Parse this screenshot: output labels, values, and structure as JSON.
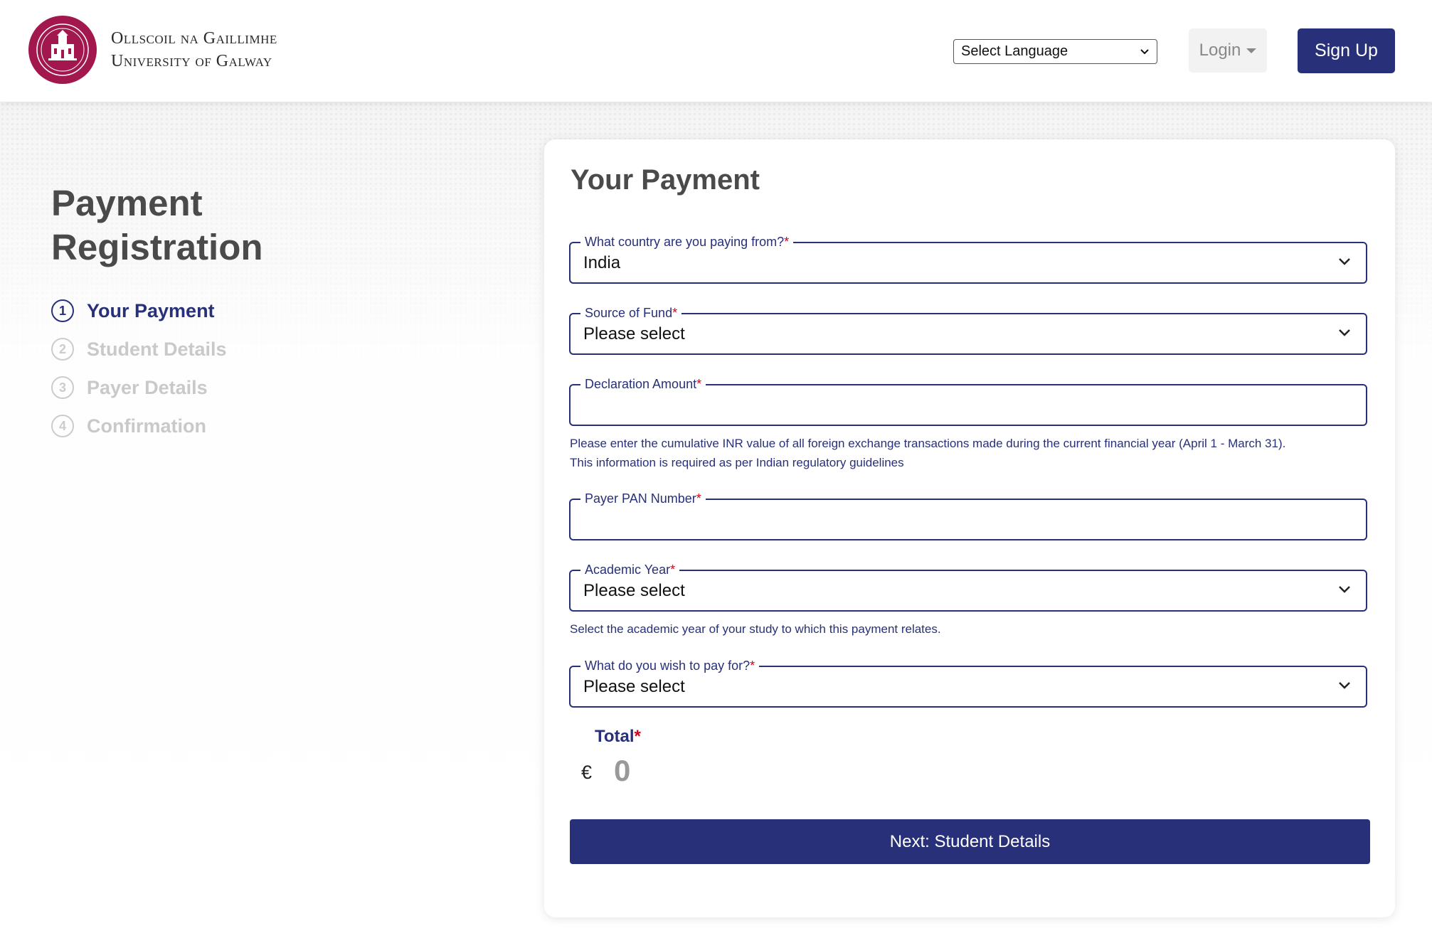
{
  "header": {
    "logo_line1": "Ollscoil na Gaillimhe",
    "logo_line2": "University of Galway",
    "language_select": "Select Language",
    "login_label": "Login",
    "signup_label": "Sign Up"
  },
  "sidebar": {
    "title": "Payment Registration",
    "steps": [
      {
        "num": "1",
        "label": "Your Payment",
        "active": true
      },
      {
        "num": "2",
        "label": "Student Details",
        "active": false
      },
      {
        "num": "3",
        "label": "Payer Details",
        "active": false
      },
      {
        "num": "4",
        "label": "Confirmation",
        "active": false
      }
    ]
  },
  "form": {
    "title": "Your Payment",
    "country": {
      "label": "What country are you paying from?",
      "required_mark": "*",
      "value": "India"
    },
    "source_of_fund": {
      "label": "Source of Fund",
      "required_mark": "*",
      "value": "Please select"
    },
    "declaration_amount": {
      "label": "Declaration Amount",
      "required_mark": "*",
      "value": "",
      "hint_line1": "Please enter the cumulative INR value of all foreign exchange transactions made during the current financial year (April 1 - March 31).",
      "hint_line2": "This information is required as per Indian regulatory guidelines"
    },
    "pan": {
      "label": "Payer PAN Number",
      "required_mark": "*",
      "value": ""
    },
    "academic_year": {
      "label": "Academic Year",
      "required_mark": "*",
      "value": "Please select",
      "hint": "Select the academic year of your study to which this payment relates."
    },
    "pay_for": {
      "label": "What do you wish to pay for?",
      "required_mark": "*",
      "value": "Please select"
    },
    "total": {
      "label": "Total",
      "required_mark": "*",
      "currency": "€",
      "value": "0"
    },
    "next_button": "Next: Student Details"
  },
  "colors": {
    "primary": "#283079",
    "required": "#d0021b",
    "seal": "#a3174f",
    "inactive_step": "#c9c9c9"
  }
}
